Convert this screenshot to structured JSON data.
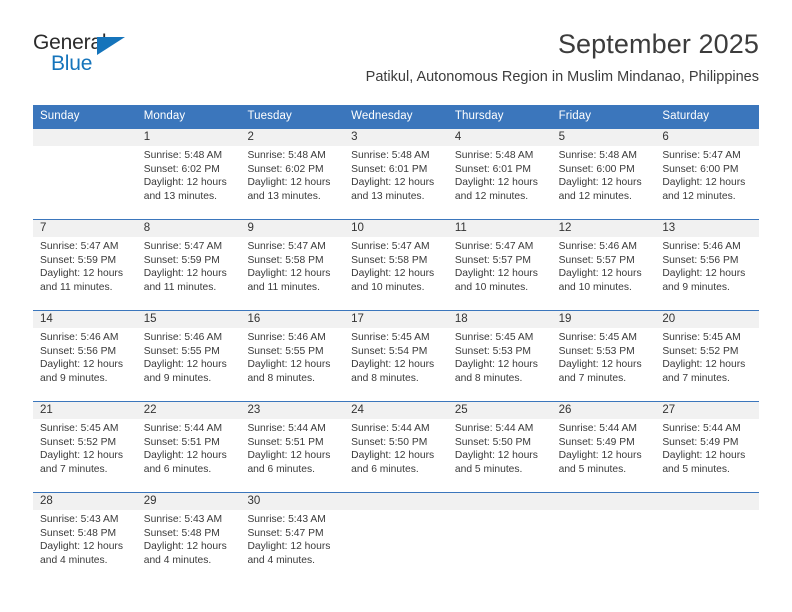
{
  "brand": {
    "name_part1": "General",
    "name_part2": "Blue",
    "triangle_color": "#1574bb"
  },
  "header": {
    "month_title": "September 2025",
    "location": "Patikul, Autonomous Region in Muslim Mindanao, Philippines",
    "header_bg_color": "#3b76bc",
    "day_band_color": "#f1f1f1"
  },
  "weekdays": [
    "Sunday",
    "Monday",
    "Tuesday",
    "Wednesday",
    "Thursday",
    "Friday",
    "Saturday"
  ],
  "weeks": [
    [
      {
        "day": "",
        "sunrise": "",
        "sunset": "",
        "daylight_line1": "",
        "daylight_line2": ""
      },
      {
        "day": "1",
        "sunrise": "Sunrise: 5:48 AM",
        "sunset": "Sunset: 6:02 PM",
        "daylight_line1": "Daylight: 12 hours",
        "daylight_line2": "and 13 minutes."
      },
      {
        "day": "2",
        "sunrise": "Sunrise: 5:48 AM",
        "sunset": "Sunset: 6:02 PM",
        "daylight_line1": "Daylight: 12 hours",
        "daylight_line2": "and 13 minutes."
      },
      {
        "day": "3",
        "sunrise": "Sunrise: 5:48 AM",
        "sunset": "Sunset: 6:01 PM",
        "daylight_line1": "Daylight: 12 hours",
        "daylight_line2": "and 13 minutes."
      },
      {
        "day": "4",
        "sunrise": "Sunrise: 5:48 AM",
        "sunset": "Sunset: 6:01 PM",
        "daylight_line1": "Daylight: 12 hours",
        "daylight_line2": "and 12 minutes."
      },
      {
        "day": "5",
        "sunrise": "Sunrise: 5:48 AM",
        "sunset": "Sunset: 6:00 PM",
        "daylight_line1": "Daylight: 12 hours",
        "daylight_line2": "and 12 minutes."
      },
      {
        "day": "6",
        "sunrise": "Sunrise: 5:47 AM",
        "sunset": "Sunset: 6:00 PM",
        "daylight_line1": "Daylight: 12 hours",
        "daylight_line2": "and 12 minutes."
      }
    ],
    [
      {
        "day": "7",
        "sunrise": "Sunrise: 5:47 AM",
        "sunset": "Sunset: 5:59 PM",
        "daylight_line1": "Daylight: 12 hours",
        "daylight_line2": "and 11 minutes."
      },
      {
        "day": "8",
        "sunrise": "Sunrise: 5:47 AM",
        "sunset": "Sunset: 5:59 PM",
        "daylight_line1": "Daylight: 12 hours",
        "daylight_line2": "and 11 minutes."
      },
      {
        "day": "9",
        "sunrise": "Sunrise: 5:47 AM",
        "sunset": "Sunset: 5:58 PM",
        "daylight_line1": "Daylight: 12 hours",
        "daylight_line2": "and 11 minutes."
      },
      {
        "day": "10",
        "sunrise": "Sunrise: 5:47 AM",
        "sunset": "Sunset: 5:58 PM",
        "daylight_line1": "Daylight: 12 hours",
        "daylight_line2": "and 10 minutes."
      },
      {
        "day": "11",
        "sunrise": "Sunrise: 5:47 AM",
        "sunset": "Sunset: 5:57 PM",
        "daylight_line1": "Daylight: 12 hours",
        "daylight_line2": "and 10 minutes."
      },
      {
        "day": "12",
        "sunrise": "Sunrise: 5:46 AM",
        "sunset": "Sunset: 5:57 PM",
        "daylight_line1": "Daylight: 12 hours",
        "daylight_line2": "and 10 minutes."
      },
      {
        "day": "13",
        "sunrise": "Sunrise: 5:46 AM",
        "sunset": "Sunset: 5:56 PM",
        "daylight_line1": "Daylight: 12 hours",
        "daylight_line2": "and 9 minutes."
      }
    ],
    [
      {
        "day": "14",
        "sunrise": "Sunrise: 5:46 AM",
        "sunset": "Sunset: 5:56 PM",
        "daylight_line1": "Daylight: 12 hours",
        "daylight_line2": "and 9 minutes."
      },
      {
        "day": "15",
        "sunrise": "Sunrise: 5:46 AM",
        "sunset": "Sunset: 5:55 PM",
        "daylight_line1": "Daylight: 12 hours",
        "daylight_line2": "and 9 minutes."
      },
      {
        "day": "16",
        "sunrise": "Sunrise: 5:46 AM",
        "sunset": "Sunset: 5:55 PM",
        "daylight_line1": "Daylight: 12 hours",
        "daylight_line2": "and 8 minutes."
      },
      {
        "day": "17",
        "sunrise": "Sunrise: 5:45 AM",
        "sunset": "Sunset: 5:54 PM",
        "daylight_line1": "Daylight: 12 hours",
        "daylight_line2": "and 8 minutes."
      },
      {
        "day": "18",
        "sunrise": "Sunrise: 5:45 AM",
        "sunset": "Sunset: 5:53 PM",
        "daylight_line1": "Daylight: 12 hours",
        "daylight_line2": "and 8 minutes."
      },
      {
        "day": "19",
        "sunrise": "Sunrise: 5:45 AM",
        "sunset": "Sunset: 5:53 PM",
        "daylight_line1": "Daylight: 12 hours",
        "daylight_line2": "and 7 minutes."
      },
      {
        "day": "20",
        "sunrise": "Sunrise: 5:45 AM",
        "sunset": "Sunset: 5:52 PM",
        "daylight_line1": "Daylight: 12 hours",
        "daylight_line2": "and 7 minutes."
      }
    ],
    [
      {
        "day": "21",
        "sunrise": "Sunrise: 5:45 AM",
        "sunset": "Sunset: 5:52 PM",
        "daylight_line1": "Daylight: 12 hours",
        "daylight_line2": "and 7 minutes."
      },
      {
        "day": "22",
        "sunrise": "Sunrise: 5:44 AM",
        "sunset": "Sunset: 5:51 PM",
        "daylight_line1": "Daylight: 12 hours",
        "daylight_line2": "and 6 minutes."
      },
      {
        "day": "23",
        "sunrise": "Sunrise: 5:44 AM",
        "sunset": "Sunset: 5:51 PM",
        "daylight_line1": "Daylight: 12 hours",
        "daylight_line2": "and 6 minutes."
      },
      {
        "day": "24",
        "sunrise": "Sunrise: 5:44 AM",
        "sunset": "Sunset: 5:50 PM",
        "daylight_line1": "Daylight: 12 hours",
        "daylight_line2": "and 6 minutes."
      },
      {
        "day": "25",
        "sunrise": "Sunrise: 5:44 AM",
        "sunset": "Sunset: 5:50 PM",
        "daylight_line1": "Daylight: 12 hours",
        "daylight_line2": "and 5 minutes."
      },
      {
        "day": "26",
        "sunrise": "Sunrise: 5:44 AM",
        "sunset": "Sunset: 5:49 PM",
        "daylight_line1": "Daylight: 12 hours",
        "daylight_line2": "and 5 minutes."
      },
      {
        "day": "27",
        "sunrise": "Sunrise: 5:44 AM",
        "sunset": "Sunset: 5:49 PM",
        "daylight_line1": "Daylight: 12 hours",
        "daylight_line2": "and 5 minutes."
      }
    ],
    [
      {
        "day": "28",
        "sunrise": "Sunrise: 5:43 AM",
        "sunset": "Sunset: 5:48 PM",
        "daylight_line1": "Daylight: 12 hours",
        "daylight_line2": "and 4 minutes."
      },
      {
        "day": "29",
        "sunrise": "Sunrise: 5:43 AM",
        "sunset": "Sunset: 5:48 PM",
        "daylight_line1": "Daylight: 12 hours",
        "daylight_line2": "and 4 minutes."
      },
      {
        "day": "30",
        "sunrise": "Sunrise: 5:43 AM",
        "sunset": "Sunset: 5:47 PM",
        "daylight_line1": "Daylight: 12 hours",
        "daylight_line2": "and 4 minutes."
      },
      {
        "day": "",
        "sunrise": "",
        "sunset": "",
        "daylight_line1": "",
        "daylight_line2": ""
      },
      {
        "day": "",
        "sunrise": "",
        "sunset": "",
        "daylight_line1": "",
        "daylight_line2": ""
      },
      {
        "day": "",
        "sunrise": "",
        "sunset": "",
        "daylight_line1": "",
        "daylight_line2": ""
      },
      {
        "day": "",
        "sunrise": "",
        "sunset": "",
        "daylight_line1": "",
        "daylight_line2": ""
      }
    ]
  ]
}
